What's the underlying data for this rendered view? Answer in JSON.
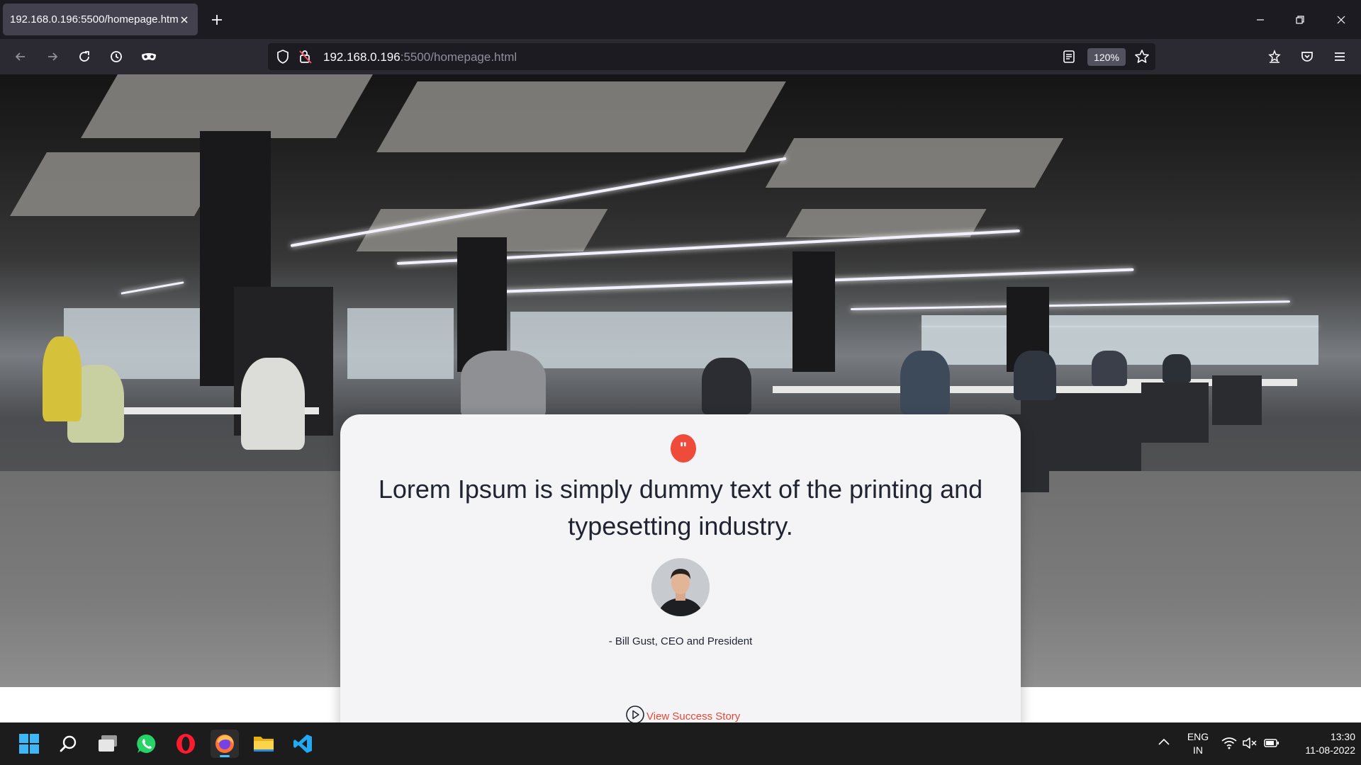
{
  "browser": {
    "tab": {
      "title": "192.168.0.196:5500/homepage.html"
    },
    "url": {
      "host": "192.168.0.196",
      "path": ":5500/homepage.html"
    },
    "zoom": "120%"
  },
  "page": {
    "quote_mark": "\"",
    "quote": "Lorem Ipsum is simply dummy text of the printing and typesetting industry.",
    "author": "- Bill Gust, CEO and President",
    "cta": "View Success Story",
    "accent_color": "#ef4b3a"
  },
  "taskbar": {
    "apps": [
      "windows-start",
      "search",
      "task-view",
      "whatsapp",
      "opera",
      "firefox",
      "file-explorer",
      "vscode"
    ],
    "language": {
      "line1": "ENG",
      "line2": "IN"
    },
    "clock": {
      "time": "13:30",
      "date": "11-08-2022"
    }
  }
}
